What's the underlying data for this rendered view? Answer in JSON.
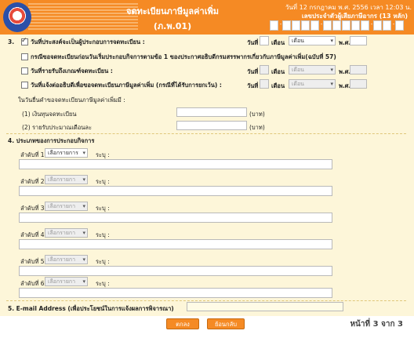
{
  "header": {
    "title": "จดทะเบียนภาษีมูลค่าเพิ่ม",
    "subtitle": "(ภ.พ.01)",
    "date_text": "วันที่ 12 กรกฎาคม พ.ศ. 2556  เวลา 12:03 น.",
    "tax_id_label": "เลขประจำตัวผู้เสียภาษีอากร (13 หลัก)"
  },
  "section3": {
    "number": "3.",
    "purpose_label": "วันที่ประสงค์จะเป็นผู้ประกอบการจดทะเบียน :",
    "option1": "กรณีขอจดทะเบียนก่อนวันเริ่มประกอบกิจการตามข้อ 1 ของประกาศอธิบดีกรมสรรพากรเกี่ยวกับภาษีมูลค่าเพิ่ม(ฉบับที่ 57)",
    "option2": "วันที่รายรับถึงเกณฑ์จดทะเบียน :",
    "option3": "วันที่แจ้งต่ออธิบดีเพื่อขอจดทะเบียนภาษีมูลค่าเพิ่ม (กรณีที่ได้รับการยกเว้น) :",
    "day_label": "วันที่",
    "month_label": "เดือน",
    "year_label": "พ.ศ.",
    "month_value": "เดือน",
    "registration_date_label": "ในวันยื่นคำขอจดทะเบียนภาษีมูลค่าเพิ่มมี :",
    "capital_label": "(1) เงินทุนจดทะเบียน",
    "income_label": "(2) รายรับประมาณเดือนละ",
    "baht": "(บาท)"
  },
  "section4": {
    "title": "4. ประเภทของการประกอบกิจการ",
    "items": [
      {
        "seq": "ลำดับที่ 1",
        "select": "เลือกรายการ",
        "desc_label": "ระบุ :"
      },
      {
        "seq": "ลำดับที่ 2",
        "select": "เลือกรายกา",
        "desc_label": "ระบุ :"
      },
      {
        "seq": "ลำดับที่ 3",
        "select": "เลือกรายกา",
        "desc_label": "ระบุ :"
      },
      {
        "seq": "ลำดับที่ 4",
        "select": "เลือกรายกา",
        "desc_label": "ระบุ :"
      },
      {
        "seq": "ลำดับที่ 5",
        "select": "เลือกรายกา",
        "desc_label": "ระบุ :"
      },
      {
        "seq": "ลำดับที่ 6",
        "select": "เลือกรายกา",
        "desc_label": "ระบุ :"
      }
    ]
  },
  "section5": {
    "label": "5. E-mail Address (เพื่อประโยชน์ในการแจ้งผลการพิจารณา)"
  },
  "footer": {
    "ok_button": "ตกลง",
    "back_button": "ย้อนกลับ",
    "page_text": "หน้าที่ 3 จาก 3"
  }
}
